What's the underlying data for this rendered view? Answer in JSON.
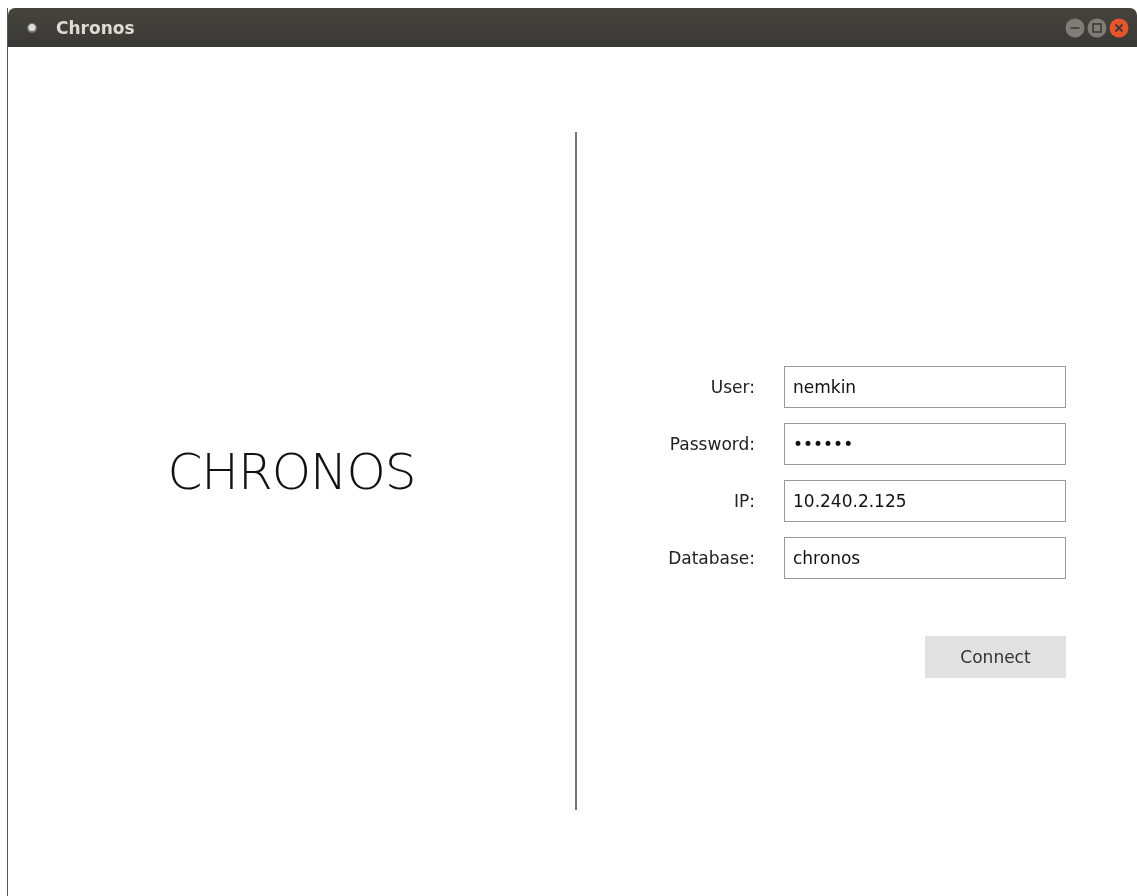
{
  "window": {
    "title": "Chronos"
  },
  "logo": {
    "text": "CHRONOS"
  },
  "form": {
    "fields": [
      {
        "label": "User:",
        "value": "nemkin"
      },
      {
        "label": "Password:",
        "value": "••••••"
      },
      {
        "label": "IP:",
        "value": "10.240.2.125"
      },
      {
        "label": "Database:",
        "value": "chronos"
      }
    ],
    "buttons": [
      "Connect"
    ]
  }
}
